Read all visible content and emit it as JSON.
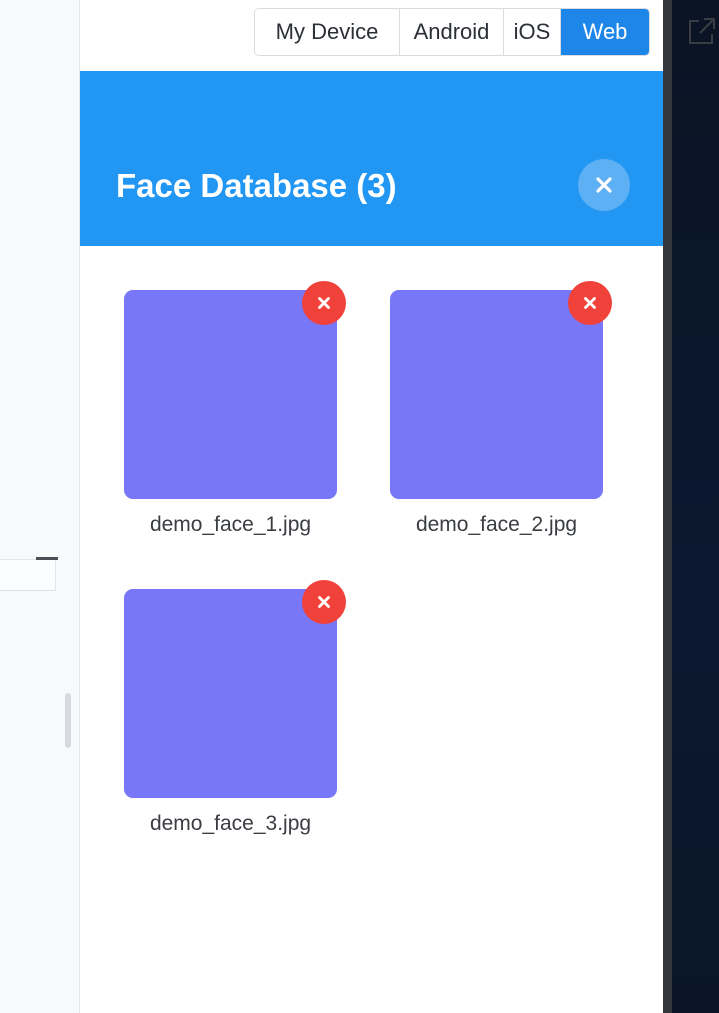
{
  "device_tabs": {
    "items": [
      {
        "label": "My Device",
        "active": false
      },
      {
        "label": "Android",
        "active": false
      },
      {
        "label": "iOS",
        "active": false
      },
      {
        "label": "Web",
        "active": true
      }
    ],
    "active_color": "#1e86e8"
  },
  "toolbar": {
    "open_external_icon": "open-external-icon"
  },
  "drawer": {
    "title": "Face Database (3)",
    "close_icon": "close-icon",
    "header_color": "#2196f3"
  },
  "faces": [
    {
      "filename": "demo_face_1.jpg",
      "thumb_color": "#7777f7",
      "remove_icon": "close-icon"
    },
    {
      "filename": "demo_face_2.jpg",
      "thumb_color": "#7777f7",
      "remove_icon": "close-icon"
    },
    {
      "filename": "demo_face_3.jpg",
      "thumb_color": "#7777f7",
      "remove_icon": "close-icon"
    }
  ],
  "colors": {
    "remove_button": "#f0413b",
    "close_button": "#5eb0f5"
  }
}
